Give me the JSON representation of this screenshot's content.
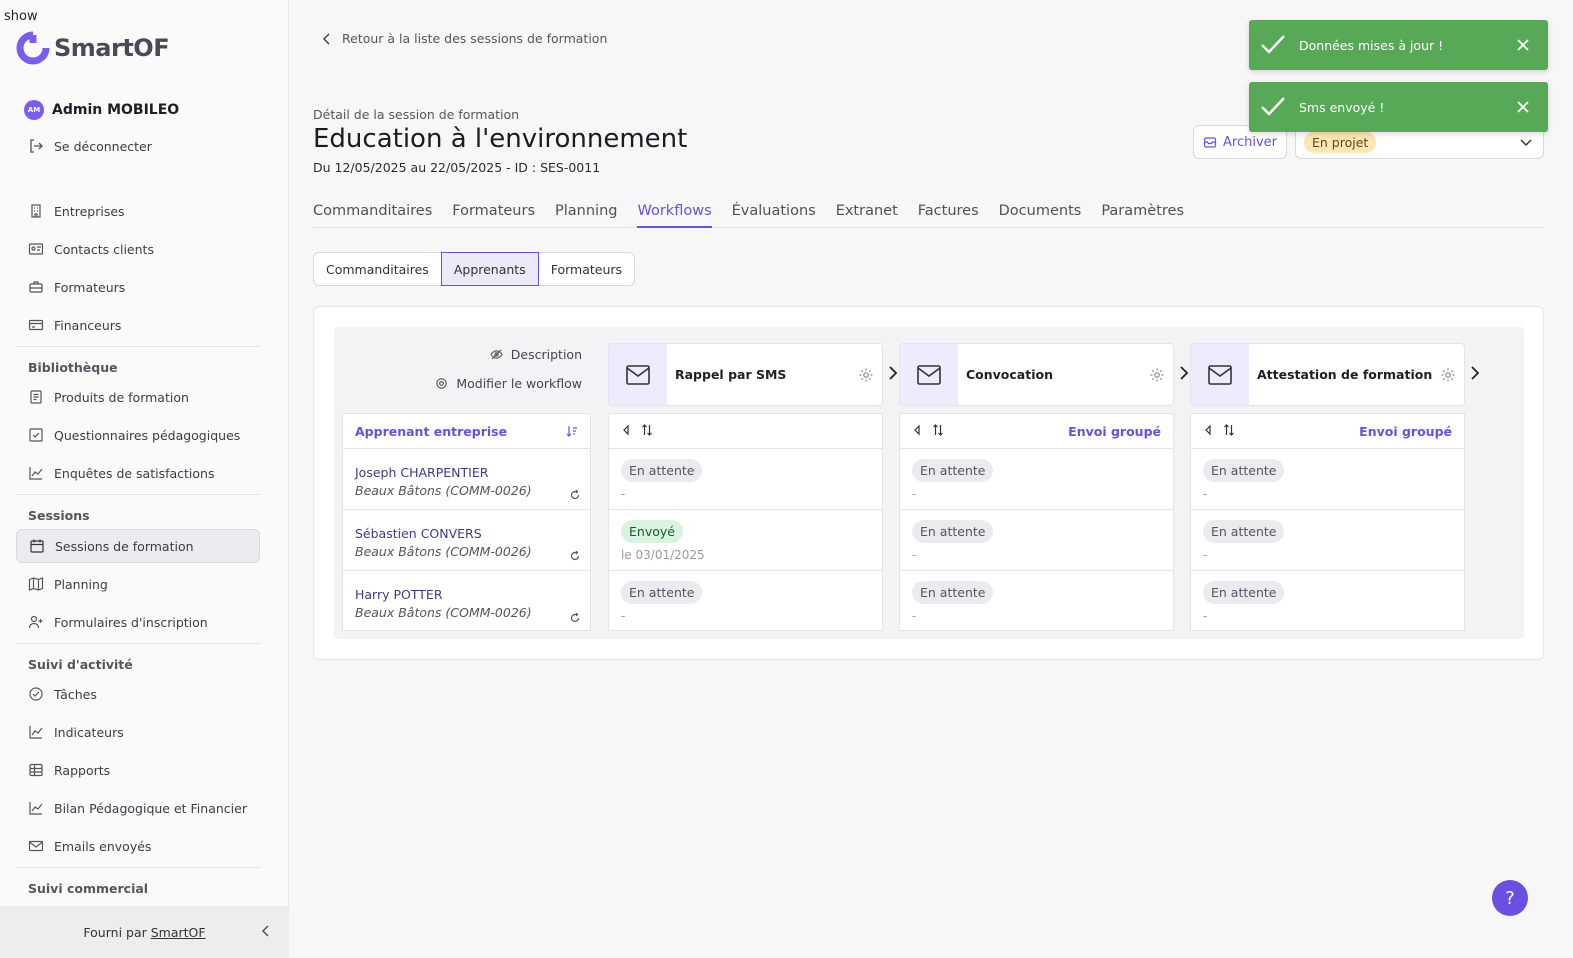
{
  "debug_label": "show",
  "brand": {
    "name": "SmartOF",
    "accent": "#6b4fe0"
  },
  "user": {
    "initials": "AM",
    "name": "Admin MOBILEO",
    "logout": "Se déconnecter"
  },
  "sidebar": {
    "group1": [
      {
        "label": "Entreprises",
        "icon": "building-icon"
      },
      {
        "label": "Contacts clients",
        "icon": "contact-card-icon"
      },
      {
        "label": "Formateurs",
        "icon": "briefcase-icon"
      },
      {
        "label": "Financeurs",
        "icon": "credit-card-icon"
      }
    ],
    "section_library": "Bibliothèque",
    "library": [
      {
        "label": "Produits de formation",
        "icon": "document-icon"
      },
      {
        "label": "Questionnaires pédagogiques",
        "icon": "checkbox-icon"
      },
      {
        "label": "Enquêtes de satisfactions",
        "icon": "chart-icon"
      }
    ],
    "section_sessions": "Sessions",
    "sessions": [
      {
        "label": "Sessions de formation",
        "icon": "calendar-icon",
        "active": true
      },
      {
        "label": "Planning",
        "icon": "map-icon"
      },
      {
        "label": "Formulaires d'inscription",
        "icon": "user-add-icon"
      }
    ],
    "section_activity": "Suivi d'activité",
    "activity": [
      {
        "label": "Tâches",
        "icon": "check-circle-icon"
      },
      {
        "label": "Indicateurs",
        "icon": "chart-icon"
      },
      {
        "label": "Rapports",
        "icon": "table-icon"
      },
      {
        "label": "Bilan Pédagogique et Financier",
        "icon": "chart-icon"
      },
      {
        "label": "Emails envoyés",
        "icon": "mail-icon"
      }
    ],
    "section_commercial": "Suivi commercial",
    "footer_prefix": "Fourni par",
    "footer_link": "SmartOF"
  },
  "header": {
    "back": "Retour à la liste des sessions de formation",
    "detail_label": "Détail de la session de formation",
    "title": "Education à l'environnement",
    "subtitle": "Du 12/05/2025 au 22/05/2025 - ID : SES-0011",
    "archive": "Archiver",
    "status": "En projet"
  },
  "tabs": [
    "Commanditaires",
    "Formateurs",
    "Planning",
    "Workflows",
    "Évaluations",
    "Extranet",
    "Factures",
    "Documents",
    "Paramètres"
  ],
  "active_tab": "Workflows",
  "subtabs": [
    "Commanditaires",
    "Apprenants",
    "Formateurs"
  ],
  "active_subtab": "Apprenants",
  "workflow": {
    "description": "Description",
    "modify": "Modifier le workflow",
    "learner_header": "Apprenant entreprise",
    "learners": [
      {
        "name": "Joseph CHARPENTIER",
        "company": "Beaux Bâtons (COMM-0026)"
      },
      {
        "name": "Sébastien CONVERS",
        "company": "Beaux Bâtons (COMM-0026)"
      },
      {
        "name": "Harry POTTER",
        "company": "Beaux Bâtons (COMM-0026)"
      }
    ],
    "steps": [
      {
        "title": "Rappel par SMS",
        "envoi": "",
        "rows": [
          {
            "status": "En attente",
            "sub": "-",
            "sent": false
          },
          {
            "status": "Envoyé",
            "sub": "le 03/01/2025",
            "sent": true
          },
          {
            "status": "En attente",
            "sub": "-",
            "sent": false
          }
        ]
      },
      {
        "title": "Convocation",
        "envoi": "Envoi groupé",
        "rows": [
          {
            "status": "En attente",
            "sub": "-",
            "sent": false
          },
          {
            "status": "En attente",
            "sub": "-",
            "sent": false
          },
          {
            "status": "En attente",
            "sub": "-",
            "sent": false
          }
        ]
      },
      {
        "title": "Attestation de formation",
        "envoi": "Envoi groupé",
        "rows": [
          {
            "status": "En attente",
            "sub": "-",
            "sent": false
          },
          {
            "status": "En attente",
            "sub": "-",
            "sent": false
          },
          {
            "status": "En attente",
            "sub": "-",
            "sent": false
          }
        ]
      }
    ]
  },
  "toasts": [
    {
      "text": "Données mises à jour !"
    },
    {
      "text": "Sms envoyé !"
    }
  ],
  "help": "?",
  "colors": {
    "toast": "#57a957",
    "status_pill": "#fbe6b6",
    "sent_badge": "#d8f3df"
  }
}
